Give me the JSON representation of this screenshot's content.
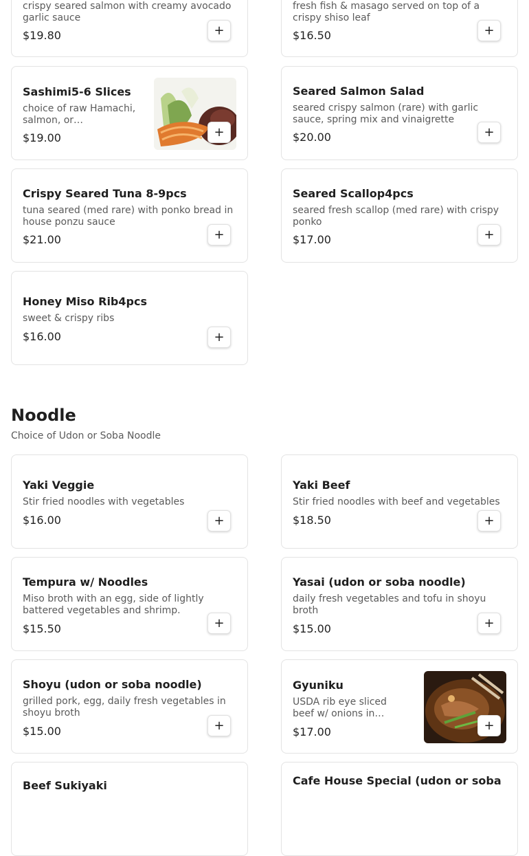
{
  "items_top": [
    {
      "desc": "crispy seared salmon with creamy avocado garlic sauce",
      "price": "$19.80"
    },
    {
      "desc": "fresh fish & masago served on top of a crispy shiso leaf",
      "price": "$16.50"
    },
    {
      "name": "Sashimi5-6 Slices",
      "desc": "choice of raw Hamachi, salmon, or…",
      "price": "$19.00",
      "image": "sashimi-photo"
    },
    {
      "name": "Seared Salmon Salad",
      "desc": "seared crispy salmon (rare) with garlic sauce, spring mix and vinaigrette",
      "price": "$20.00"
    },
    {
      "name": "Crispy Seared Tuna 8-9pcs",
      "desc": "tuna seared (med rare) with ponko bread in house ponzu sauce",
      "price": "$21.00"
    },
    {
      "name": "Seared Scallop4pcs",
      "desc": "seared fresh scallop (med rare) with crispy ponko",
      "price": "$17.00"
    },
    {
      "name": "Honey Miso Rib4pcs",
      "desc": "sweet & crispy ribs",
      "price": "$16.00"
    }
  ],
  "noodle_section": {
    "title": "Noodle",
    "subtitle": "Choice of Udon or Soba Noodle",
    "items": [
      {
        "name": "Yaki Veggie",
        "desc": "Stir fried noodles with vegetables",
        "price": "$16.00"
      },
      {
        "name": "Yaki Beef",
        "desc": "Stir fried noodles with beef and vegetables",
        "price": "$18.50"
      },
      {
        "name": "Tempura w/ Noodles",
        "desc": "Miso broth with an egg, side of lightly battered vegetables and shrimp.",
        "price": "$15.50"
      },
      {
        "name": "Yasai (udon or soba noodle)",
        "desc": "daily fresh vegetables and tofu in shoyu broth",
        "price": "$15.00"
      },
      {
        "name": "Shoyu (udon or soba noodle)",
        "desc": "grilled pork, egg, daily fresh vegetables in shoyu broth",
        "price": "$15.00"
      },
      {
        "name": "Gyuniku",
        "desc": "USDA rib eye sliced beef w/ onions in…",
        "price": "$17.00",
        "image": "gyuniku-photo"
      },
      {
        "name": "Beef Sukiyaki"
      },
      {
        "name": "Cafe House Special (udon or soba"
      }
    ]
  },
  "add_button_label": "+",
  "colors": {
    "card_border": "#e3e3e3",
    "text_primary": "#1f1f1f",
    "text_secondary": "#5a5a5a"
  }
}
